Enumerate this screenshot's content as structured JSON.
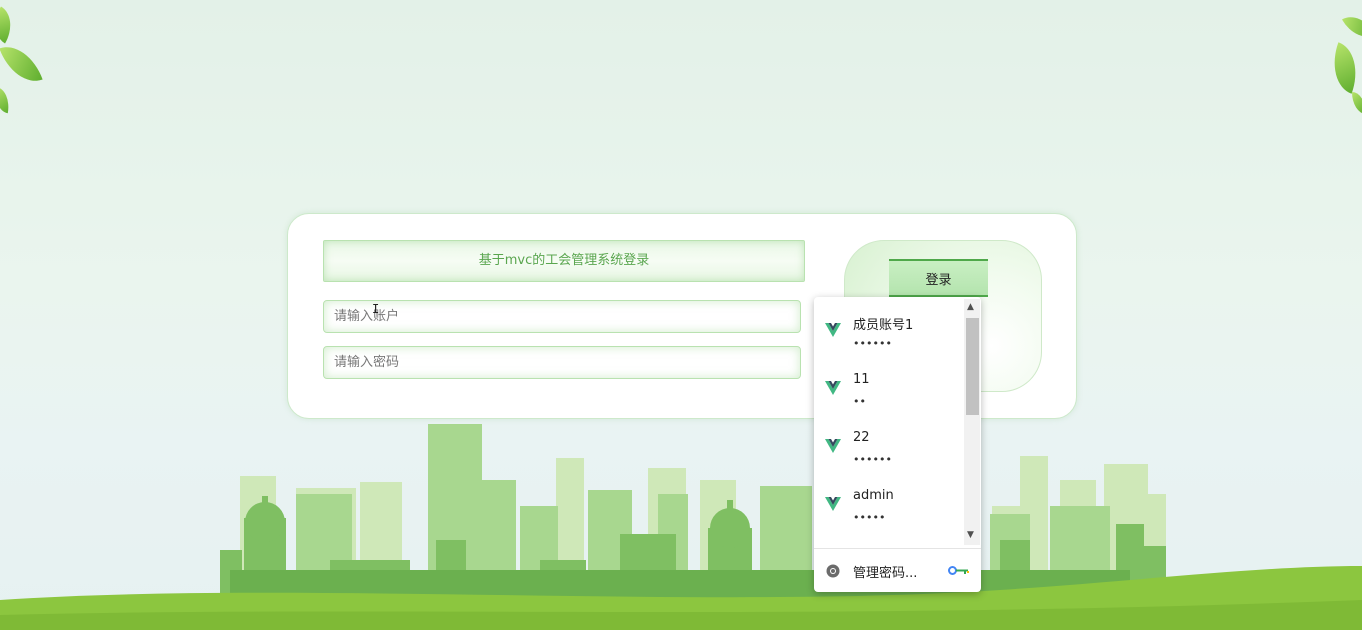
{
  "login": {
    "title": "基于mvc的工会管理系统登录",
    "account_placeholder": "请输入账户",
    "password_placeholder": "请输入密码",
    "login_button": "登录"
  },
  "autofill": {
    "items": [
      {
        "username": "成员账号1",
        "password_mask": "••••••"
      },
      {
        "username": "11",
        "password_mask": "••"
      },
      {
        "username": "22",
        "password_mask": "••••••"
      },
      {
        "username": "admin",
        "password_mask": "•••••"
      }
    ],
    "manage_label": "管理密码...",
    "item_icon": "vue-logo-icon",
    "manage_icon": "chrome-icon",
    "key_icon": "key-icon"
  },
  "colors": {
    "accent_green": "#4fa84a",
    "title_text": "#5aa64f",
    "ground_green": "#8cc63f"
  }
}
